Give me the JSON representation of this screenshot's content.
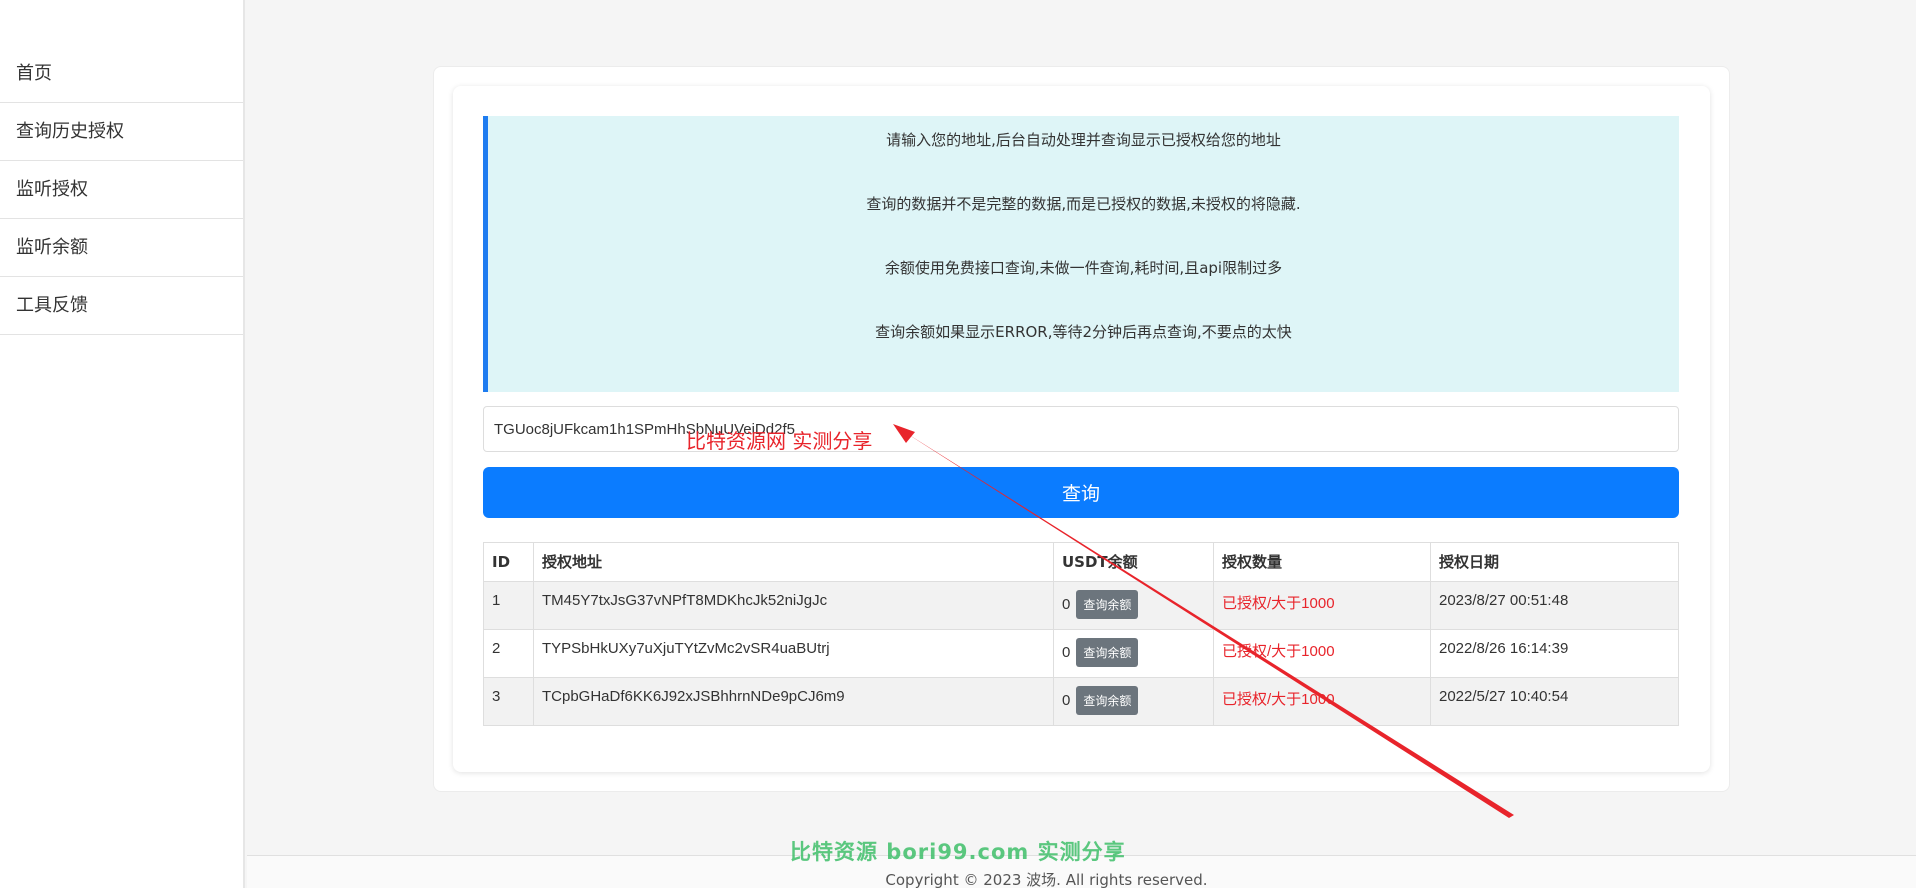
{
  "sidebar": {
    "items": [
      {
        "label": "首页"
      },
      {
        "label": "查询历史授权"
      },
      {
        "label": "监听授权"
      },
      {
        "label": "监听余额"
      },
      {
        "label": "工具反馈"
      }
    ]
  },
  "notice": {
    "lines": [
      "请输入您的地址,后台自动处理并查询显示已授权给您的地址",
      "查询的数据并不是完整的数据,而是已授权的数据,未授权的将隐藏.",
      "余额使用免费接口查询,未做一件查询,耗时间,且api限制过多",
      "查询余额如果显示ERROR,等待2分钟后再点查询,不要点的太快"
    ]
  },
  "search": {
    "value": "TGUoc8jUFkcam1h1SPmHhSbNuUVeiDd2f5",
    "button_label": "查询"
  },
  "table": {
    "headers": [
      "ID",
      "授权地址",
      "USDT余额",
      "授权数量",
      "授权日期"
    ],
    "balance_button_label": "查询余额",
    "rows": [
      {
        "id": "1",
        "address": "TM45Y7txJsG37vNPfT8MDKhcJk52niJgJc",
        "balance": "0",
        "amount": "已授权/大于1000",
        "date": "2023/8/27 00:51:48"
      },
      {
        "id": "2",
        "address": "TYPSbHkUXy7uXjuTYtZvMc2vSR4uaBUtrj",
        "balance": "0",
        "amount": "已授权/大于1000",
        "date": "2022/8/26 16:14:39"
      },
      {
        "id": "3",
        "address": "TCpbGHaDf6KK6J92xJSBhhrnNDe9pCJ6m9",
        "balance": "0",
        "amount": "已授权/大于1000",
        "date": "2022/5/27 10:40:54"
      }
    ]
  },
  "watermarks": {
    "red": "比特资源网 实测分享",
    "green": "比特资源 bori99.com 实测分享"
  },
  "footer": {
    "copyright": "Copyright © 2023 波场. All rights reserved."
  },
  "colors": {
    "primary": "#0b7cff",
    "notice_bg": "#def5f7",
    "notice_border": "#1e7cf0",
    "status_red": "#e8242b",
    "button_gray": "#6c757d"
  }
}
